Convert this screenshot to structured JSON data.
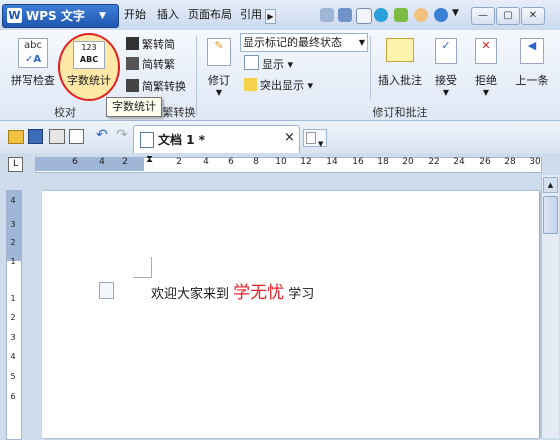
{
  "app": {
    "name": "WPS 文字",
    "logo_letter": "W"
  },
  "menu": [
    "开始",
    "插入",
    "页面布局",
    "引用"
  ],
  "ribbon": {
    "proofing": {
      "spell": "拼写检查",
      "wordcount": "字数统计",
      "wordcount_icon_num": "123",
      "wordcount_icon_abc": "ABC",
      "spell_icon": "abc",
      "group": "校对"
    },
    "chinese": {
      "to_trad": "繁转简",
      "to_simp": "简转繁",
      "convert": "简繁转换",
      "group_partial": "繁转换"
    },
    "track": {
      "revise": "修订",
      "status": "显示标记的最终状态",
      "show": "显示",
      "highlight": "突出显示"
    },
    "comments": {
      "insert": "插入批注",
      "accept": "接受",
      "reject": "拒绝",
      "prev": "上一条",
      "group": "修订和批注"
    }
  },
  "tooltip": "字数统计",
  "doctab": {
    "name": "文档 1",
    "modified": "*",
    "close": "×"
  },
  "ruler": {
    "h_ticks": [
      "6",
      "4",
      "2",
      "2",
      "4",
      "6",
      "8",
      "10",
      "12",
      "14",
      "16",
      "18",
      "20",
      "22",
      "24",
      "26",
      "28",
      "30"
    ],
    "v_ticks": [
      "4",
      "3",
      "2",
      "1",
      "1",
      "2",
      "3",
      "4",
      "5",
      "6"
    ]
  },
  "document": {
    "text_before": "欢迎大家来到",
    "highlight": "学无忧",
    "text_after": "学习"
  },
  "colors": {
    "highlight": "#e8202a",
    "wps_blue": "#1f56b0",
    "wordcount_ring": "#e02020"
  }
}
